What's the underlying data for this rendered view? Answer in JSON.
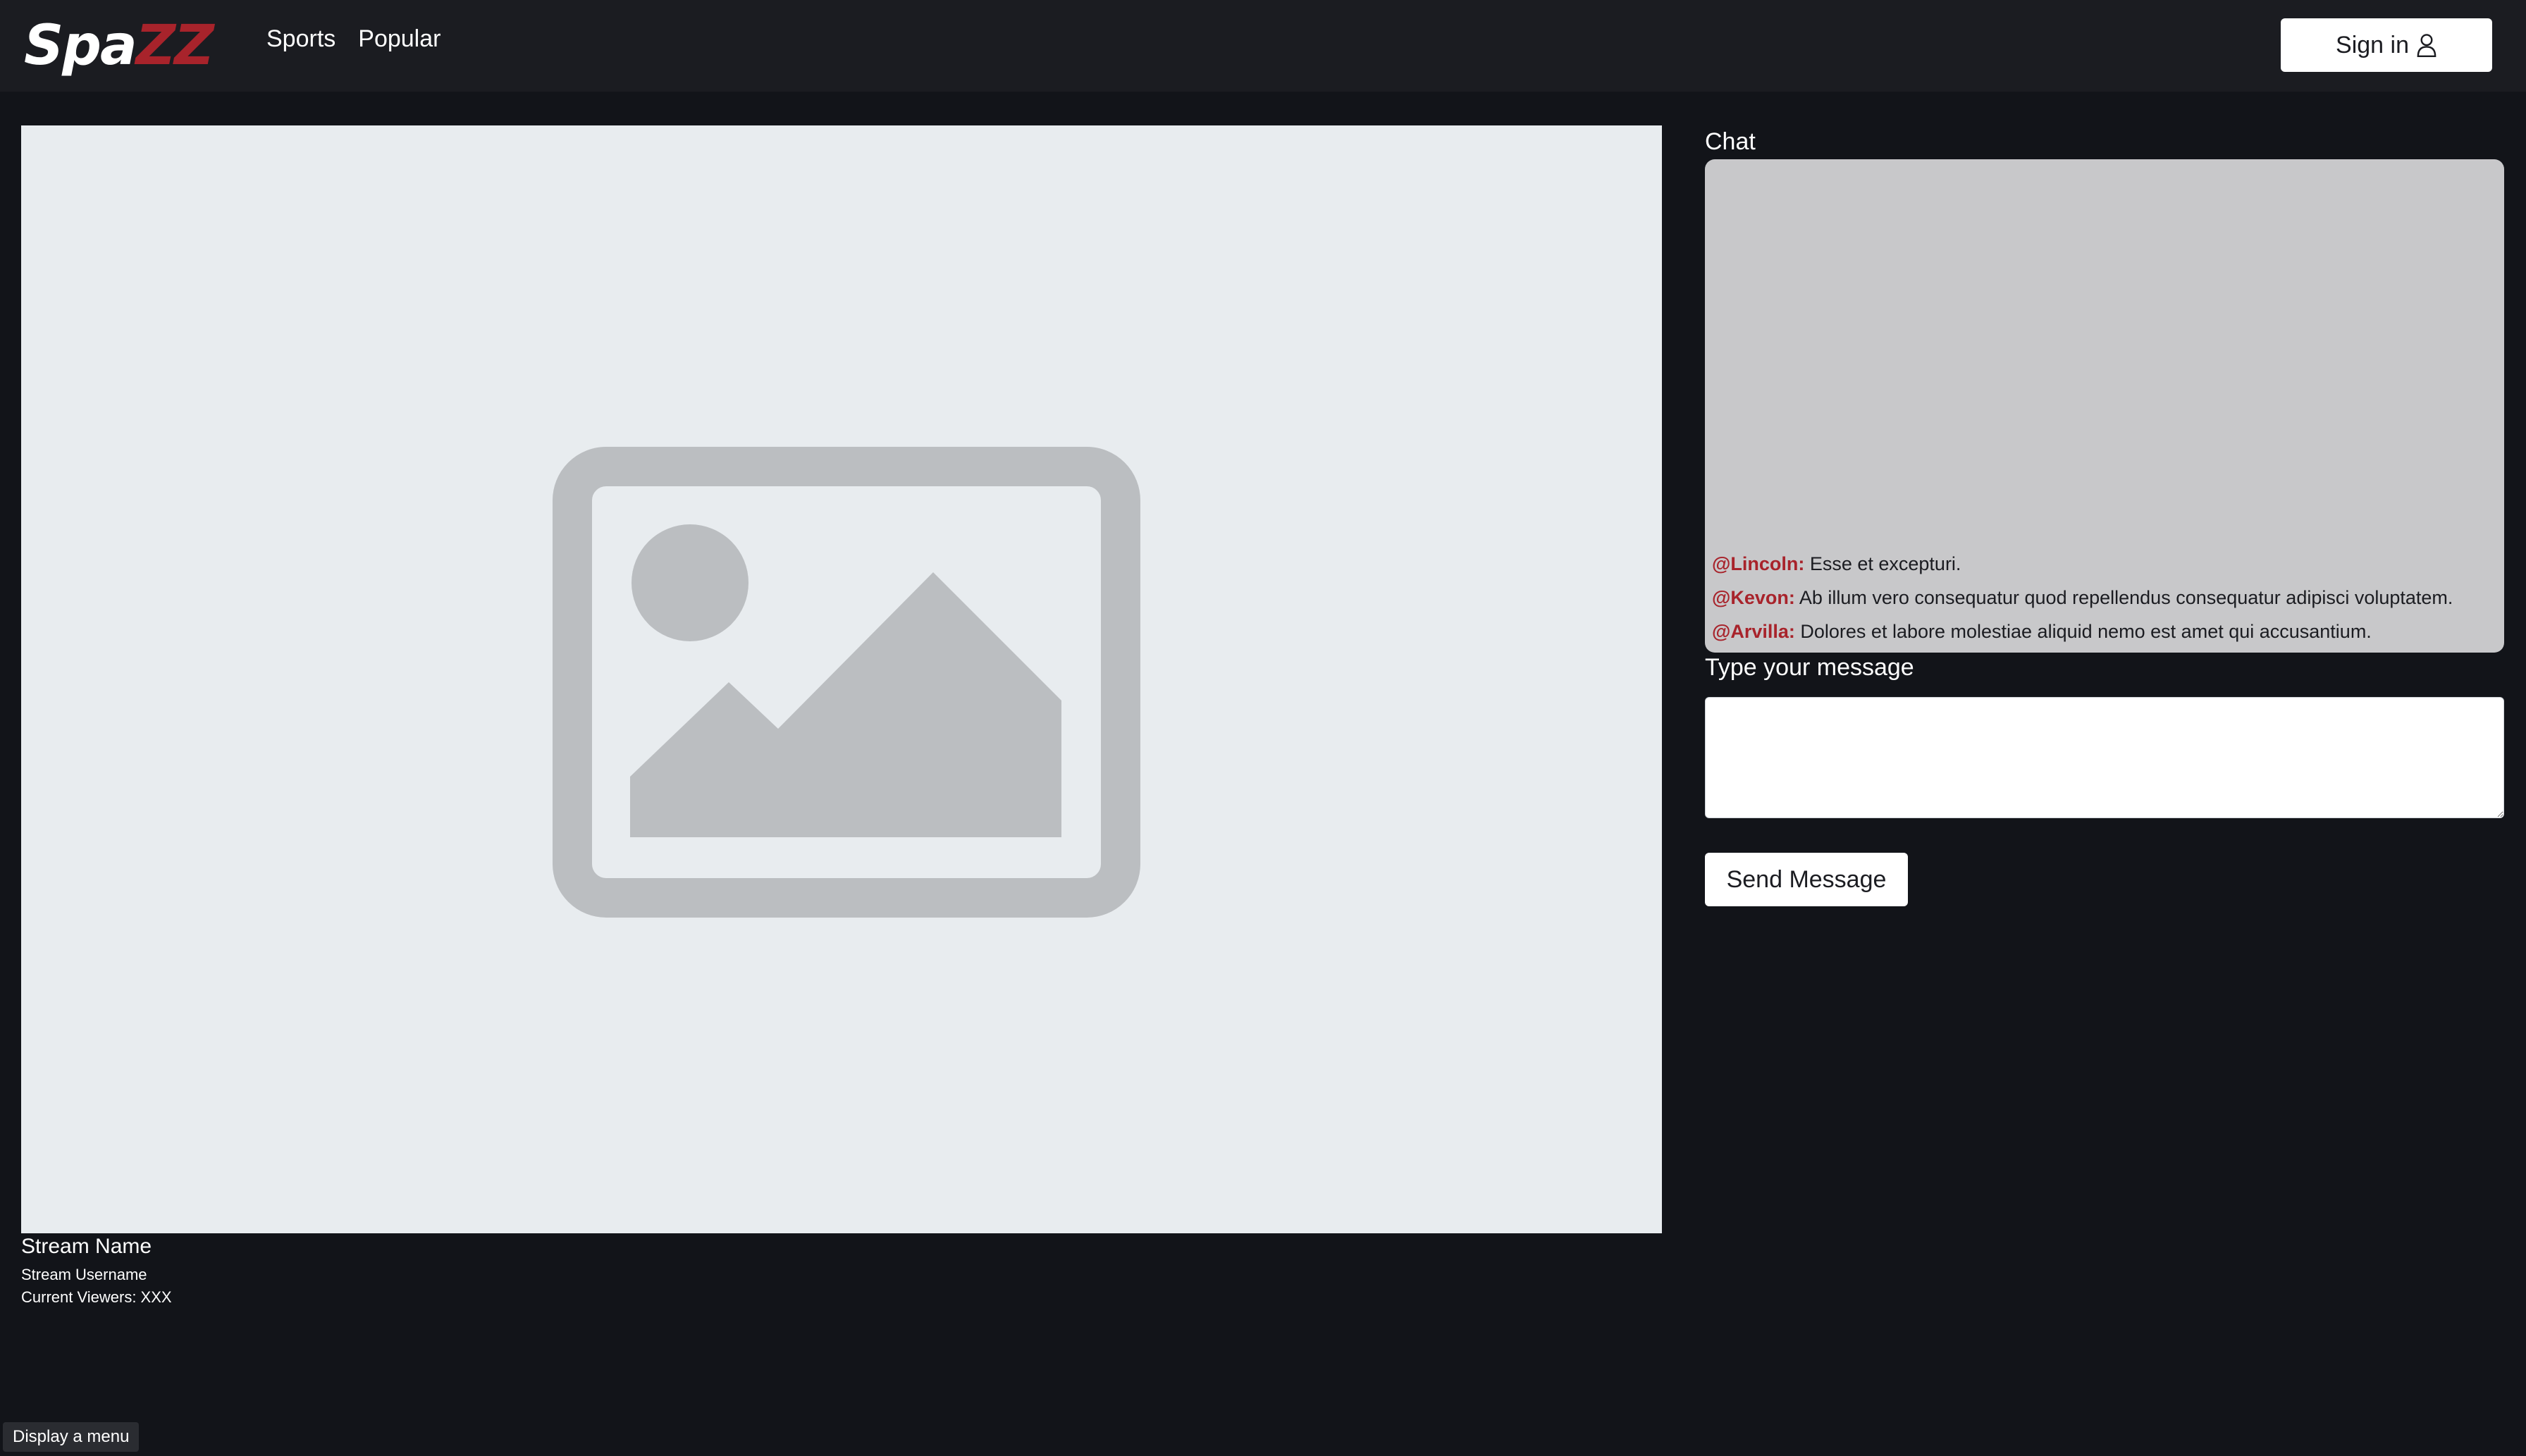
{
  "header": {
    "logo_part1": "Spa",
    "logo_part2": "ZZ",
    "nav": [
      {
        "label": "Sports"
      },
      {
        "label": "Popular"
      }
    ],
    "signin_label": "Sign in"
  },
  "player": {
    "placeholder_icon": "image-placeholder-icon"
  },
  "stream": {
    "name": "Stream Name",
    "username": "Stream Username",
    "viewers": "Current Viewers: XXX"
  },
  "chat": {
    "label": "Chat",
    "messages": [
      {
        "user": "@Lincoln:",
        "text": "Esse et excepturi."
      },
      {
        "user": "@Kevon:",
        "text": "Ab illum vero consequatur quod repellendus consequatur adipisci voluptatem."
      },
      {
        "user": "@Arvilla:",
        "text": "Dolores et labore molestiae aliquid nemo est amet qui accusantium."
      }
    ],
    "input_label": "Type your message",
    "input_value": "",
    "send_label": "Send Message"
  },
  "footer": {
    "menu_hint": "Display a menu"
  },
  "colors": {
    "background": "#121419",
    "header": "#1b1c21",
    "accent": "#a8232b",
    "player_bg": "#e8ecef",
    "chat_bg": "#c8c8ca"
  }
}
